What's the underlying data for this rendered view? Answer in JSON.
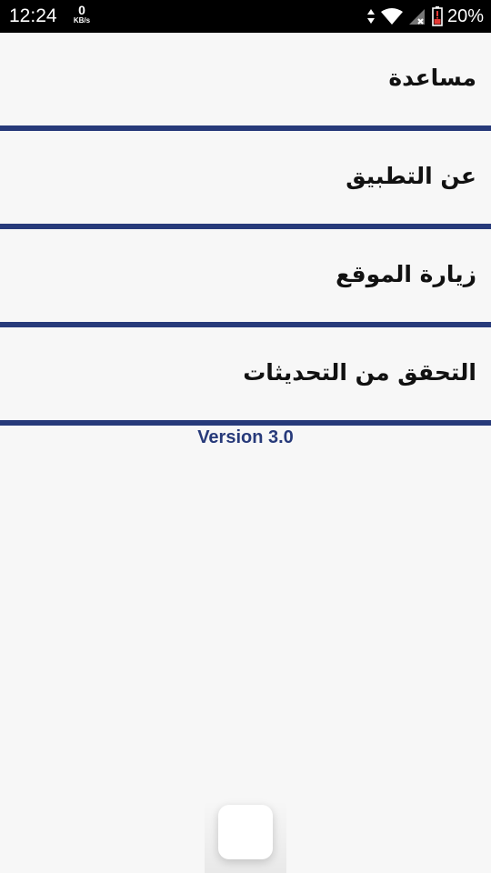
{
  "status_bar": {
    "time": "12:24",
    "net_speed_value": "0",
    "net_speed_unit": "KB/s",
    "battery_percent": "20%",
    "icons": [
      "data-arrows-icon",
      "wifi-icon",
      "cell-signal-no-data-icon",
      "battery-low-icon"
    ]
  },
  "menu": {
    "items": [
      {
        "label": "مساعدة"
      },
      {
        "label": "عن التطبيق"
      },
      {
        "label": "زيارة الموقع"
      },
      {
        "label": "التحقق من التحديثات"
      }
    ]
  },
  "version_text": "Version 3.0",
  "colors": {
    "accent": "#273a7a",
    "background": "#f7f7f7",
    "status_bar": "#000000",
    "battery_alert": "#e53935"
  }
}
